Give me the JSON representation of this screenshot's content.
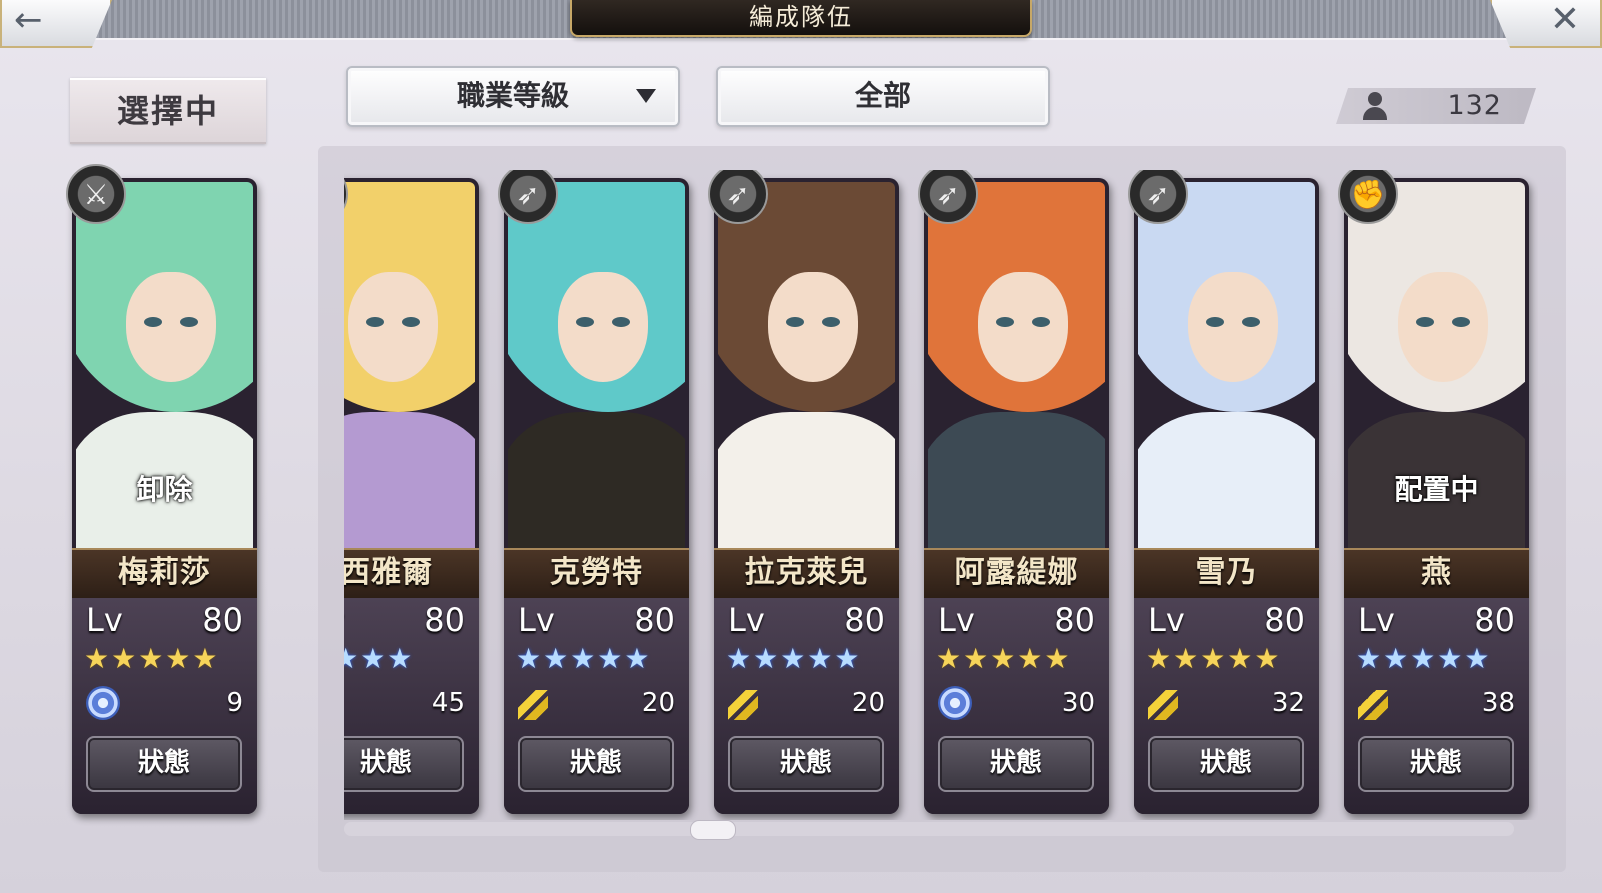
{
  "header": {
    "title": "編成隊伍",
    "back_icon": "←",
    "close_icon": "✕"
  },
  "selected_label": "選擇中",
  "filters": {
    "sort_label": "職業等級",
    "category_label": "全部"
  },
  "unit_count": "132",
  "lv_label": "Lv",
  "status_label": "狀態",
  "selected_card": {
    "name": "梅莉莎",
    "level": "80",
    "stars": "★★★★★",
    "star_color": "gold",
    "element": "wind",
    "cost": "9",
    "overlay": "卸除",
    "class_icon": "sword-icon",
    "palette": {
      "hair": "#7fd4b0",
      "body": "#e9efe9"
    }
  },
  "cards": [
    {
      "name": "西雅爾",
      "level": "80",
      "stars": "★★★★",
      "star_color": "blue",
      "element": "thunder",
      "cost": "45",
      "overlay": "",
      "class_icon": "staff-icon",
      "palette": {
        "hair": "#f2d06a",
        "body": "#b49ad1"
      }
    },
    {
      "name": "克勞特",
      "level": "80",
      "stars": "★★★★★",
      "star_color": "blue",
      "element": "thunder",
      "cost": "20",
      "overlay": "",
      "class_icon": "bow-icon",
      "palette": {
        "hair": "#5fc9c9",
        "body": "#2e2a24"
      }
    },
    {
      "name": "拉克萊兒",
      "level": "80",
      "stars": "★★★★★",
      "star_color": "blue",
      "element": "thunder",
      "cost": "20",
      "overlay": "",
      "class_icon": "bow-icon",
      "palette": {
        "hair": "#6b4a35",
        "body": "#f3f0ea"
      }
    },
    {
      "name": "阿露緹娜",
      "level": "80",
      "stars": "★★★★★",
      "star_color": "gold",
      "element": "wind",
      "cost": "30",
      "overlay": "",
      "class_icon": "bow-icon",
      "palette": {
        "hair": "#e0743a",
        "body": "#3d4a54"
      }
    },
    {
      "name": "雪乃",
      "level": "80",
      "stars": "★★★★★",
      "star_color": "gold",
      "element": "thunder",
      "cost": "32",
      "overlay": "",
      "class_icon": "bow-icon",
      "palette": {
        "hair": "#c9d9f2",
        "body": "#e7eef8"
      }
    },
    {
      "name": "燕",
      "level": "80",
      "stars": "★★★★★",
      "star_color": "blue",
      "element": "thunder",
      "cost": "38",
      "overlay": "配置中",
      "class_icon": "fist-icon",
      "palette": {
        "hair": "#ece7e2",
        "body": "#3a3336"
      }
    }
  ]
}
